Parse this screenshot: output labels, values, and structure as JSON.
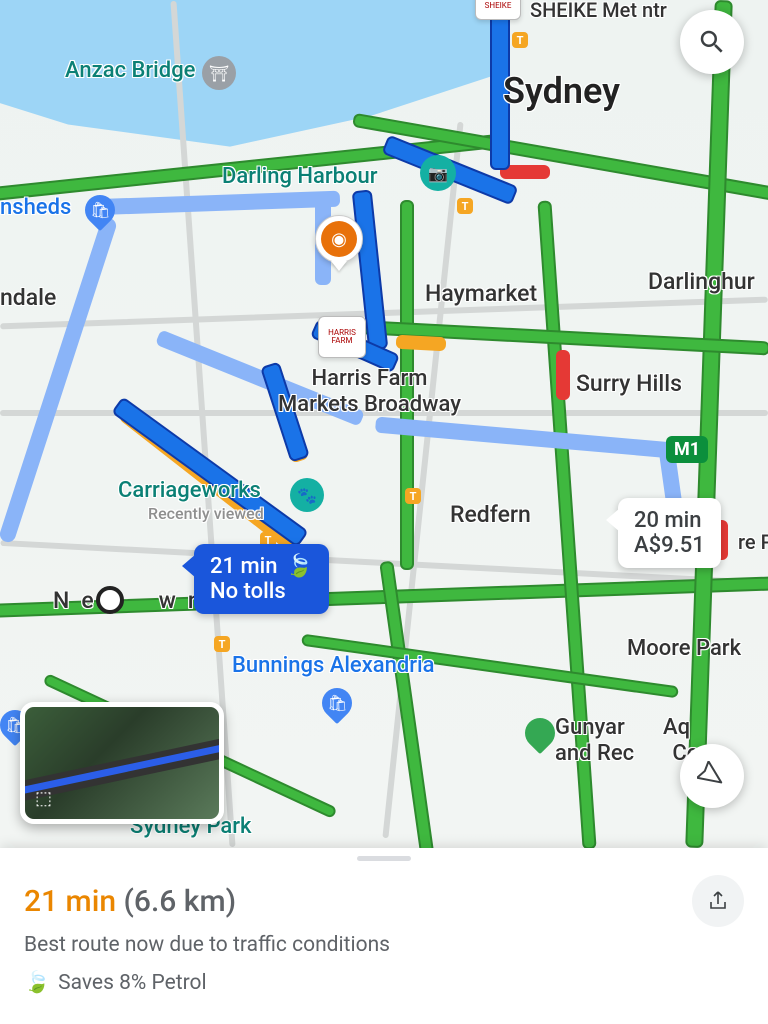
{
  "map": {
    "city_label": "Sydney",
    "districts": {
      "haymarket": "Haymarket",
      "darlinghurst": "Darlinghur",
      "surry_hills": "Surry Hills",
      "redfern": "Redfern",
      "newtown": "Newtown",
      "annandale": "ndale",
      "moore_park": "Moore Park",
      "sydenham_partial": "nsheds"
    },
    "poi": {
      "anzac_bridge": "Anzac Bridge",
      "darling_harbour": "Darling Harbour",
      "harris_farm": "Harris Farm\nMarkets Broadway",
      "carriageworks": "Carriageworks",
      "carriageworks_sub": "Recently viewed",
      "bunnings": "Bunnings Alexandria",
      "gunyama": "Gunyar       Aq\nand Rec        Ce",
      "sydney_park": "Sydney Park",
      "sheike": "SHEIKE Met       ntr",
      "sheike_tag": "SHEIKE",
      "moore_p": "re P"
    },
    "motorway": "M1",
    "transit_letter": "T"
  },
  "routes": {
    "primary": {
      "time": "21 min",
      "note": "No tolls"
    },
    "alt": {
      "time": "20 min",
      "cost": "A$9.51"
    }
  },
  "sheet": {
    "time": "21 min",
    "distance": "(6.6 km)",
    "sub": "Best route now due to traffic conditions",
    "eco": "Saves 8% Petrol"
  },
  "colors": {
    "route_primary": "#1a56db",
    "traffic_green": "#3fb83f",
    "traffic_orange": "#f5a623",
    "traffic_red": "#e53935",
    "alt_route": "#8ab4f8"
  }
}
